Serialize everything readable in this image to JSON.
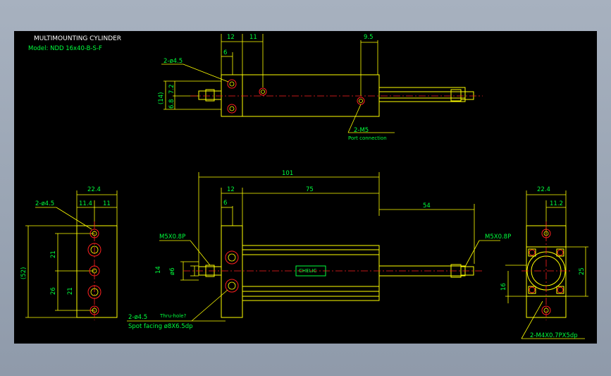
{
  "title_block": {
    "title": "MULTIMOUNTING CYLINDER",
    "model": "Model: NDD 16x40-B-S-F"
  },
  "top_view": {
    "dims": {
      "d12": "12",
      "d11": "11",
      "d6": "6",
      "d9_5": "9.5",
      "hole": "2-ø4.5",
      "d14": "(14)",
      "d7_2": "7.2",
      "d6_8": "6.8",
      "port": "2-M5",
      "port_note": "Port connection"
    }
  },
  "front_view": {
    "dims": {
      "d101": "101",
      "d12": "12",
      "d75": "75",
      "d6": "6",
      "d54": "54",
      "thread_left": "M5X0.8P",
      "thread_right": "M5X0.8P",
      "d14": "14",
      "d6v": "ø6",
      "hole_note_1": "2-ø4.5",
      "hole_note_1b": "Thru-hole?",
      "hole_note_2": "Spot facing ø8X6.5dp",
      "brand": "CHELIC"
    }
  },
  "left_view": {
    "dims": {
      "d22_4": "22.4",
      "d11_4": "11.4",
      "d11": "11",
      "hole": "2-ø4.5",
      "d52": "(52)",
      "d21": "21",
      "d26": "26",
      "d21b": "21"
    }
  },
  "right_view": {
    "dims": {
      "d22_4": "22.4",
      "d11_2": "11.2",
      "d25": "25",
      "d16": "16",
      "tap": "2-M4X0.7PX5dp"
    }
  }
}
